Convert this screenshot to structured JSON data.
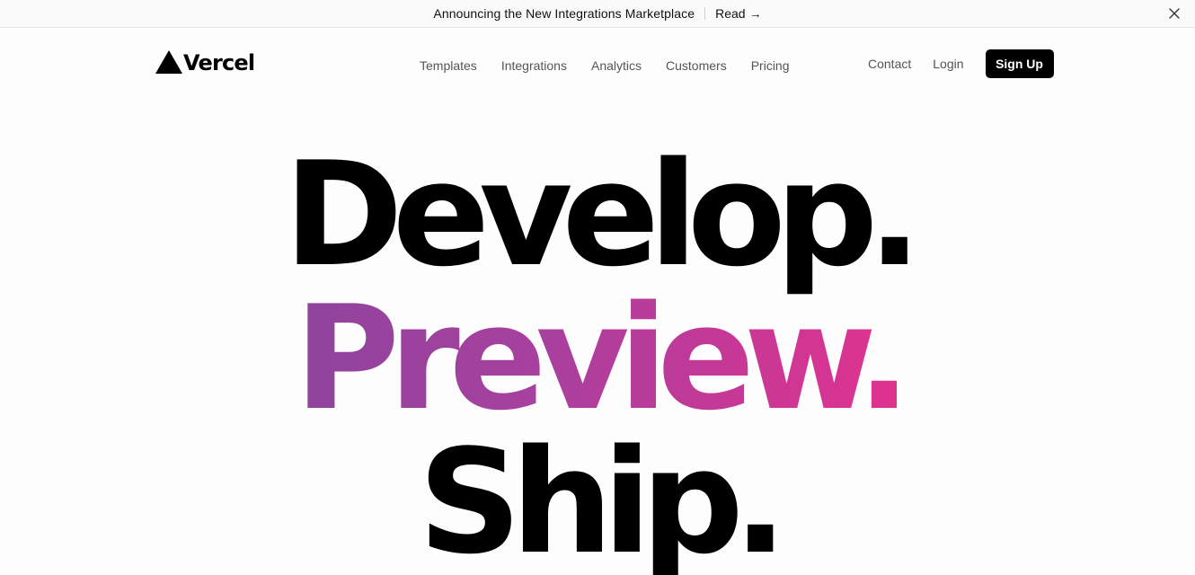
{
  "banner": {
    "announcement": "Announcing the New Integrations Marketplace",
    "read_label": "Read",
    "read_arrow": "→",
    "close_icon": "close-icon"
  },
  "header": {
    "logo_text": "Vercel",
    "logo_icon": "triangle-logo-icon",
    "nav": [
      "Templates",
      "Integrations",
      "Analytics",
      "Customers",
      "Pricing"
    ],
    "contact_label": "Contact",
    "login_label": "Login",
    "signup_label": "Sign Up"
  },
  "hero": {
    "line1": "Develop.",
    "line2": "Preview.",
    "line3": "Ship."
  },
  "colors": {
    "gradient_start": "#6f4a9c",
    "gradient_end": "#ee1c84",
    "primary": "#000000"
  }
}
